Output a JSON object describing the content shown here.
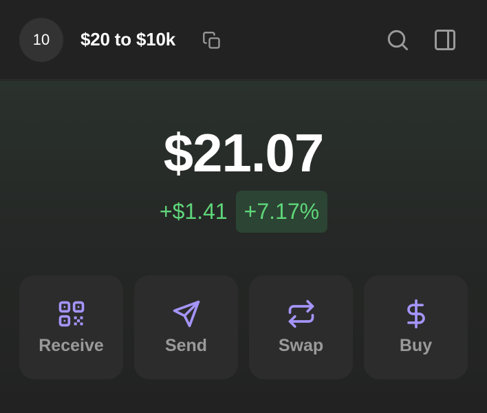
{
  "header": {
    "avatar_text": "10",
    "wallet_name": "$20 to $10k",
    "icons": [
      "copy-icon",
      "search-icon",
      "side-panel-icon"
    ]
  },
  "portfolio": {
    "balance": "$21.07",
    "change_amount": "+$1.41",
    "change_percent": "+7.17%",
    "change_color": "#5fd67a"
  },
  "actions": [
    {
      "label": "Receive",
      "icon": "qr-code-icon"
    },
    {
      "label": "Send",
      "icon": "send-icon"
    },
    {
      "label": "Swap",
      "icon": "swap-icon"
    },
    {
      "label": "Buy",
      "icon": "dollar-icon"
    }
  ],
  "colors": {
    "accent": "#a594f9",
    "background": "#222222",
    "card": "#2c2c2c",
    "positive": "#5fd67a"
  }
}
